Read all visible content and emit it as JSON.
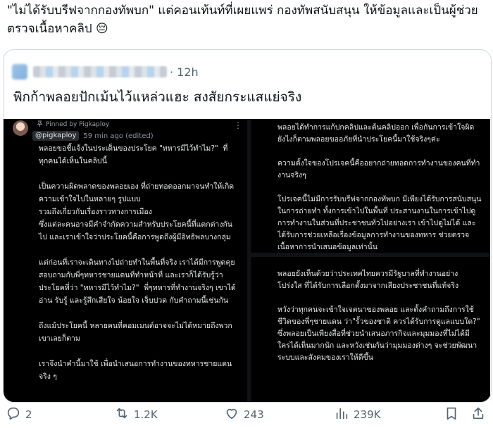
{
  "post": {
    "text": "\"ไม่ได้รับบรีฟจากกองทัพบก\" แต่คอนเท้นท์ที่เผยแพร่ กองทัพสนับสนุน ให้ข้อมูลและเป็นผู้ช่วยตรวจเนื้อหาคลิป 😔"
  },
  "quote": {
    "time": "· 12h",
    "text": "พิกก้าพลอยปักเม้นไว้แหล่วแฮะ สงสัยกระแสแย่จริง"
  },
  "screenshot": {
    "pinned_label": "Pinned by Pigkaploy",
    "handle": "@pigkaploy",
    "meta": "59 min ago (edited)",
    "left_body": "พลอยขอชี้แจ้งในประเด็นของประโยค \"ทหารมีไว้ทำไม?\"  ที่ทุกคนได้เห็นในคลิปนี้\n\nเป็นความผิดพลาดของพลอยเอง ที่ถ่ายทอดออกมาจนทำให้เกิดความเข้าใจไปในหลายๆ รูปแบบ\nรวมถึงเกี่ยวกับเรื่องราวทางการเมือง\nซึ่งแต่ละคนอาจมีคำจำกัดความสำหรับประโยคนี้ที่แตกต่างกันไป และเราเข้าใจว่าประโยคนี้คือการพูดถึงผู้มีอิทธิพลบางกลุ่ม\n\nแต่ก่อนที่เราจะเดินทางไปถ่ายทำในพื้นที่จริง เราได้มีการพูดคุยสอบถามกับพี่ๆทหารชายแดนที่ทำหน้าที่ และเราก็ได้รับรู้ว่าประโยคที่ว่า \"ทหารมีไว้ทำไม?\"  พี่ๆทหารที่ทำงานจริงๆ เขาได้อ่าน รับรู้ และรู้สึกเสียใจ น้อยใจ เจ็บปวด กับคำถามนี้เช่นกัน\n\nถึงแม้ประโยคนี้ หลายคนที่คอมเมนต์อาจจะไม่ได้หมายถึงพวกเขาเลยก็ตาม\n\nเราจึงนำคำนี้มาใช้ เพื่อนำเสนอการทำงานของทหารชายแดนจริง ๆ",
    "right_top_body": "พลอยได้ทำการแก้ปกคลิปและต้นคลิปออก เพื่อกันการเข้าใจผิด ยังไงก็ตามพลอยขออภัยที่นำประโยคนี้มาใช้จริงๆค่ะ\n\nความตั้งใจของโปรเจคนี้คืออยากถ่ายทอดการทำงานของคนที่ทำงานจริงๆ\n\nโปรเจคนี้ไม่มีการรับบรีฟจากกองทัพบก มีเพียงได้รับการสนับสนุนในการถ่ายทำ ทั้งการเข้าไปในพื้นที่ ประสานงานในการเข้าไปดูการทำงานในส่วนที่ประชาชนทั่วไปอย่างเรา เข้าไปดูไม่ได้ และได้รับการช่วยเหลือเรื่องข้อมูลการทำงานของทหาร ช่วยตรวจเนื้อหาการนำเสนอข้อมูลเท่านั้น",
    "right_bottom_body": "พลอยยังเห็นด้วยว่าประเทศไทยควรมีรัฐบาลที่ทำงานอย่างโปร่งใส ที่ได้รับการเลือกตั้งมาจากเสียงประชาชนที่แท้จริง\n\nหวังว่าทุกคนจะเข้าใจเจตนาของพลอย และตั้งคำถามถึงการใช้ชีวิตของพี่ๆชายแดน ว่า\"รั้วของชาติ ควรได้รับการดูแลแบบใด?\" ซึ่งพลอยเป็นเพียงสื่อที่ช่วยนำเสนอภารกิจและมุมมองที่ไม่ได้มีใครได้เห็นมากนัก และหวังเช่นกันว่ามุมมองต่างๆ จะช่วยพัฒนาระบบและสังคมของเราให้ดีขึ้น"
  },
  "actions": {
    "replies": "2",
    "reposts": "1.2K",
    "likes": "243",
    "views": "239K"
  },
  "colors": {
    "text": "#0f1419",
    "muted": "#536471",
    "border": "#cfd9de",
    "media_bg": "#000000"
  }
}
